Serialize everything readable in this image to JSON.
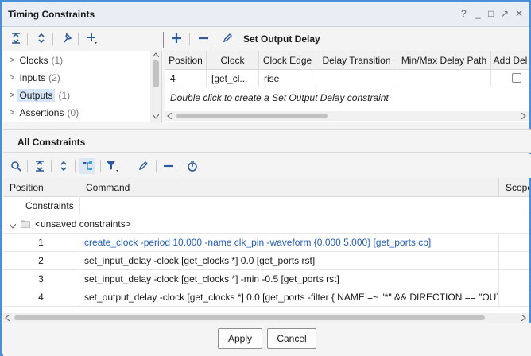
{
  "window": {
    "title": "Timing Constraints",
    "controls": [
      "?",
      "_",
      "□",
      "↗",
      "✕"
    ]
  },
  "tree": {
    "items": [
      {
        "label": "Clocks",
        "count": "(1)",
        "selected": false
      },
      {
        "label": "Inputs",
        "count": "(2)",
        "selected": false
      },
      {
        "label": "Outputs",
        "count": "(1)",
        "selected": true
      },
      {
        "label": "Assertions",
        "count": "(0)",
        "selected": false
      }
    ]
  },
  "grid": {
    "title": "Set Output Delay",
    "columns": [
      "Position",
      "Clock",
      "Clock Edge",
      "Delay Transition",
      "Min/Max Delay Path",
      "Add Del"
    ],
    "row": {
      "position": "4",
      "clock": "[get_cl...",
      "edge": "rise"
    },
    "hint": "Double click to create a Set Output Delay constraint"
  },
  "all_constraints": {
    "title": "All Constraints",
    "columns": [
      "Position",
      "Command",
      "Scope"
    ],
    "constraints_label": "Constraints",
    "group_label": "<unsaved constraints>",
    "rows": [
      {
        "position": "1",
        "command": "create_clock -period 10.000 -name clk_pin -waveform {0.000 5.000} [get_ports cp]",
        "highlight": true
      },
      {
        "position": "2",
        "command": "set_input_delay -clock [get_clocks *] 0.0 [get_ports rst]",
        "highlight": false
      },
      {
        "position": "3",
        "command": "set_input_delay -clock [get_clocks *] -min -0.5 [get_ports rst]",
        "highlight": false
      },
      {
        "position": "4",
        "command": "set_output_delay -clock [get_clocks *] 0.0 [get_ports -filter { NAME =~  \"*\" && DIRECTION == \"OUT\" }]",
        "highlight": false
      }
    ]
  },
  "footer": {
    "apply": "Apply",
    "cancel": "Cancel"
  }
}
